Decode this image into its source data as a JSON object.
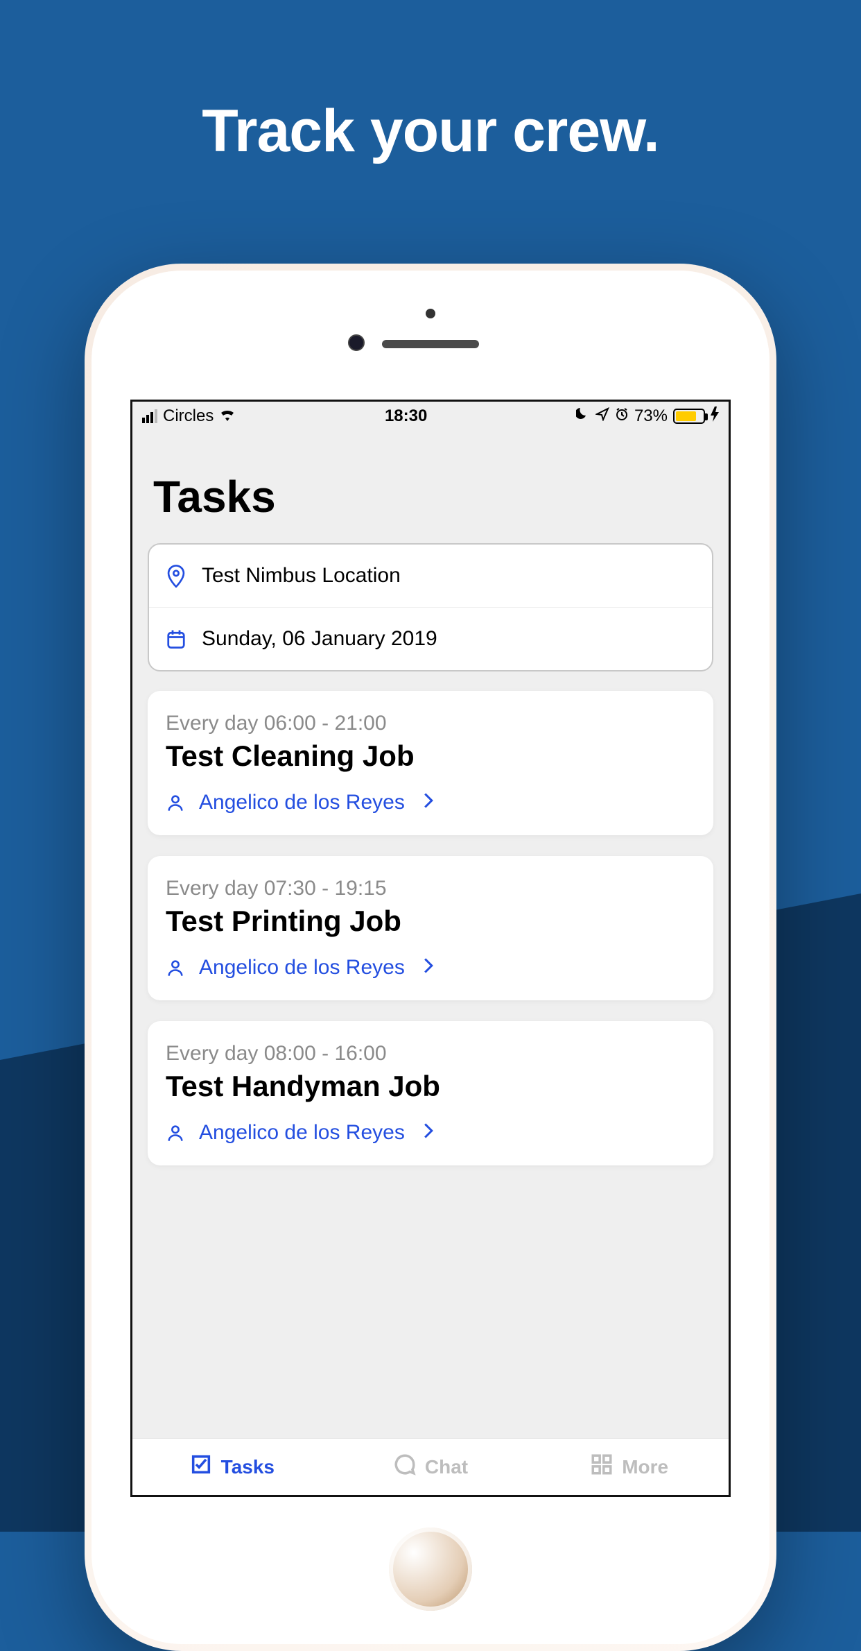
{
  "marketing": {
    "headline": "Track your crew."
  },
  "status": {
    "carrier": "Circles",
    "time": "18:30",
    "battery_pct": "73%"
  },
  "page": {
    "title": "Tasks"
  },
  "filters": {
    "location": "Test Nimbus Location",
    "date": "Sunday, 06 January 2019"
  },
  "tasks": [
    {
      "schedule": "Every day 06:00 - 21:00",
      "title": "Test Cleaning Job",
      "assignee": "Angelico de los Reyes"
    },
    {
      "schedule": "Every day 07:30 - 19:15",
      "title": "Test Printing Job",
      "assignee": "Angelico de los Reyes"
    },
    {
      "schedule": "Every day 08:00 - 16:00",
      "title": "Test Handyman Job",
      "assignee": "Angelico de los Reyes"
    }
  ],
  "tabs": {
    "tasks": "Tasks",
    "chat": "Chat",
    "more": "More"
  }
}
